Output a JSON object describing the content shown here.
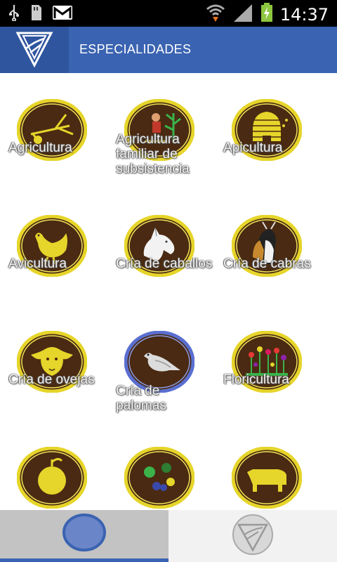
{
  "status_bar": {
    "time": "14:37",
    "icons": [
      "usb-icon",
      "sd-card-icon",
      "gmail-icon",
      "wifi-icon",
      "signal-icon",
      "battery-charging-icon"
    ]
  },
  "header": {
    "title": "ESPECIALIDADES",
    "logo_icon": "club-emblem-icon"
  },
  "specialties": [
    {
      "label": "Agricultura",
      "icon": "plow-icon"
    },
    {
      "label": "Agricultura familiar de subsistencia",
      "icon": "farmer-plant-icon"
    },
    {
      "label": "Apicultura",
      "icon": "beehive-icon"
    },
    {
      "label": "Avicultura",
      "icon": "hen-icon"
    },
    {
      "label": "Cría de caballos",
      "icon": "horse-icon"
    },
    {
      "label": "Cría de cabras",
      "icon": "goats-icon"
    },
    {
      "label": "Cría de ovejas",
      "icon": "sheep-icon"
    },
    {
      "label": "Cría de palomas",
      "icon": "pigeon-icon"
    },
    {
      "label": "Floricultura",
      "icon": "flowers-icon"
    },
    {
      "label": "",
      "icon": "fruit-icon"
    },
    {
      "label": "",
      "icon": "vegetables-icon"
    },
    {
      "label": "",
      "icon": "cattle-icon"
    }
  ],
  "tabs": [
    {
      "name": "tab-specialties",
      "icon": "circle-badge-icon",
      "active": true
    },
    {
      "name": "tab-emblem",
      "icon": "club-emblem-icon",
      "active": false
    }
  ],
  "colors": {
    "header_blue": "#3a63b1",
    "badge_brown": "#4a2a12",
    "badge_yellow": "#e6d52a",
    "pigeon_border": "#5a6fd0"
  }
}
